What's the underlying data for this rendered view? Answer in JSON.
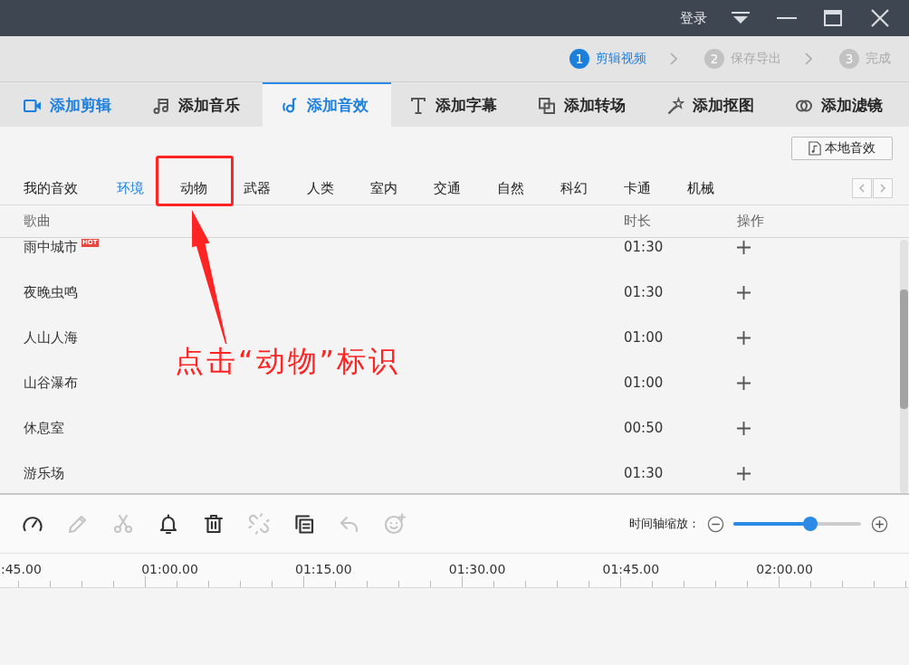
{
  "window": {
    "login": "登录"
  },
  "steps": [
    {
      "number": "1",
      "label": "剪辑视频",
      "selected": true
    },
    {
      "number": "2",
      "label": "保存导出",
      "selected": false
    },
    {
      "number": "3",
      "label": "完成",
      "selected": false
    }
  ],
  "tabs": [
    {
      "kind": "video",
      "label": "添加剪辑",
      "selected": false,
      "highlighted": true
    },
    {
      "kind": "music",
      "label": "添加音乐",
      "selected": false,
      "highlighted": false
    },
    {
      "kind": "sound",
      "label": "添加音效",
      "selected": true,
      "highlighted": false
    },
    {
      "kind": "text",
      "label": "添加字幕",
      "selected": false,
      "highlighted": false
    },
    {
      "kind": "transition",
      "label": "添加转场",
      "selected": false,
      "highlighted": false
    },
    {
      "kind": "cutout",
      "label": "添加抠图",
      "selected": false,
      "highlighted": false
    },
    {
      "kind": "filter",
      "label": "添加滤镜",
      "selected": false,
      "highlighted": false
    }
  ],
  "local_button": {
    "label": "本地音效"
  },
  "categories": [
    {
      "label": "我的音效",
      "selected": false
    },
    {
      "label": "环境",
      "selected": true
    },
    {
      "label": "动物",
      "selected": false
    },
    {
      "label": "武器",
      "selected": false
    },
    {
      "label": "人类",
      "selected": false
    },
    {
      "label": "室内",
      "selected": false
    },
    {
      "label": "交通",
      "selected": false
    },
    {
      "label": "自然",
      "selected": false
    },
    {
      "label": "科幻",
      "selected": false
    },
    {
      "label": "卡通",
      "selected": false
    },
    {
      "label": "机械",
      "selected": false
    }
  ],
  "table": {
    "columns": [
      "歌曲",
      "时长",
      "操作"
    ],
    "rows": [
      {
        "name": "雨中城市",
        "badge": "HOT",
        "duration": "01:30"
      },
      {
        "name": "夜晚虫鸣",
        "duration": "01:30"
      },
      {
        "name": "人山人海",
        "duration": "01:00"
      },
      {
        "name": "山谷瀑布",
        "duration": "01:00"
      },
      {
        "name": "休息室",
        "duration": "00:50"
      },
      {
        "name": "游乐场",
        "duration": "01:30"
      }
    ]
  },
  "toolbar": {
    "tools": [
      {
        "kind": "speed",
        "disabled": false
      },
      {
        "kind": "edit",
        "disabled": true
      },
      {
        "kind": "cut",
        "disabled": true
      },
      {
        "kind": "bell",
        "disabled": false
      },
      {
        "kind": "delete",
        "disabled": false
      },
      {
        "kind": "unlink",
        "disabled": true
      },
      {
        "kind": "copy",
        "disabled": false
      },
      {
        "kind": "undo",
        "disabled": true
      },
      {
        "kind": "sticker",
        "disabled": true
      }
    ],
    "zoom": {
      "label": "时间轴缩放：",
      "level": 0.6
    }
  },
  "timeline": {
    "labels": [
      ":45.00",
      "01:00.00",
      "01:15.00",
      "01:30.00",
      "01:45.00",
      "02:00.00"
    ]
  },
  "annotation": {
    "text": "点击“动物”标识"
  }
}
